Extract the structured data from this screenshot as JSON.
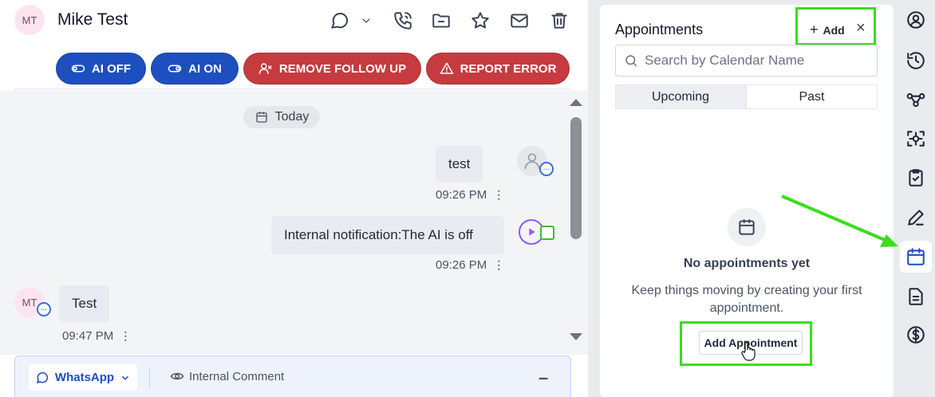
{
  "conversation": {
    "initials": "MT",
    "name": "Mike Test",
    "actions": {
      "ai_off": "AI OFF",
      "ai_on": "AI ON",
      "remove_follow_up": "REMOVE FOLLOW UP",
      "report_error": "REPORT ERROR"
    },
    "date_chip": "Today",
    "messages": [
      {
        "text": "test",
        "time": "09:26 PM"
      },
      {
        "text": "Internal notification:The AI is off",
        "time": "09:26 PM"
      },
      {
        "text": "Test",
        "time": "09:47 PM",
        "sender_initials": "MT"
      }
    ],
    "composer": {
      "channel": "WhatsApp",
      "internal_comment": "Internal Comment"
    }
  },
  "appointments": {
    "title": "Appointments",
    "add_label": "Add",
    "search_placeholder": "Search by Calendar Name",
    "tabs": [
      "Upcoming",
      "Past"
    ],
    "empty_title": "No appointments yet",
    "empty_text": "Keep things moving by creating your first appointment.",
    "add_appointment_label": "Add Appointment"
  },
  "colors": {
    "accent": "#1d4fbf",
    "danger": "#c53b3f",
    "highlight": "#3cdd1c"
  },
  "rail_icons": [
    "contact-icon",
    "history-icon",
    "workflow-icon",
    "scan-icon",
    "task-icon",
    "note-icon",
    "calendar-icon",
    "document-icon",
    "payment-icon"
  ]
}
